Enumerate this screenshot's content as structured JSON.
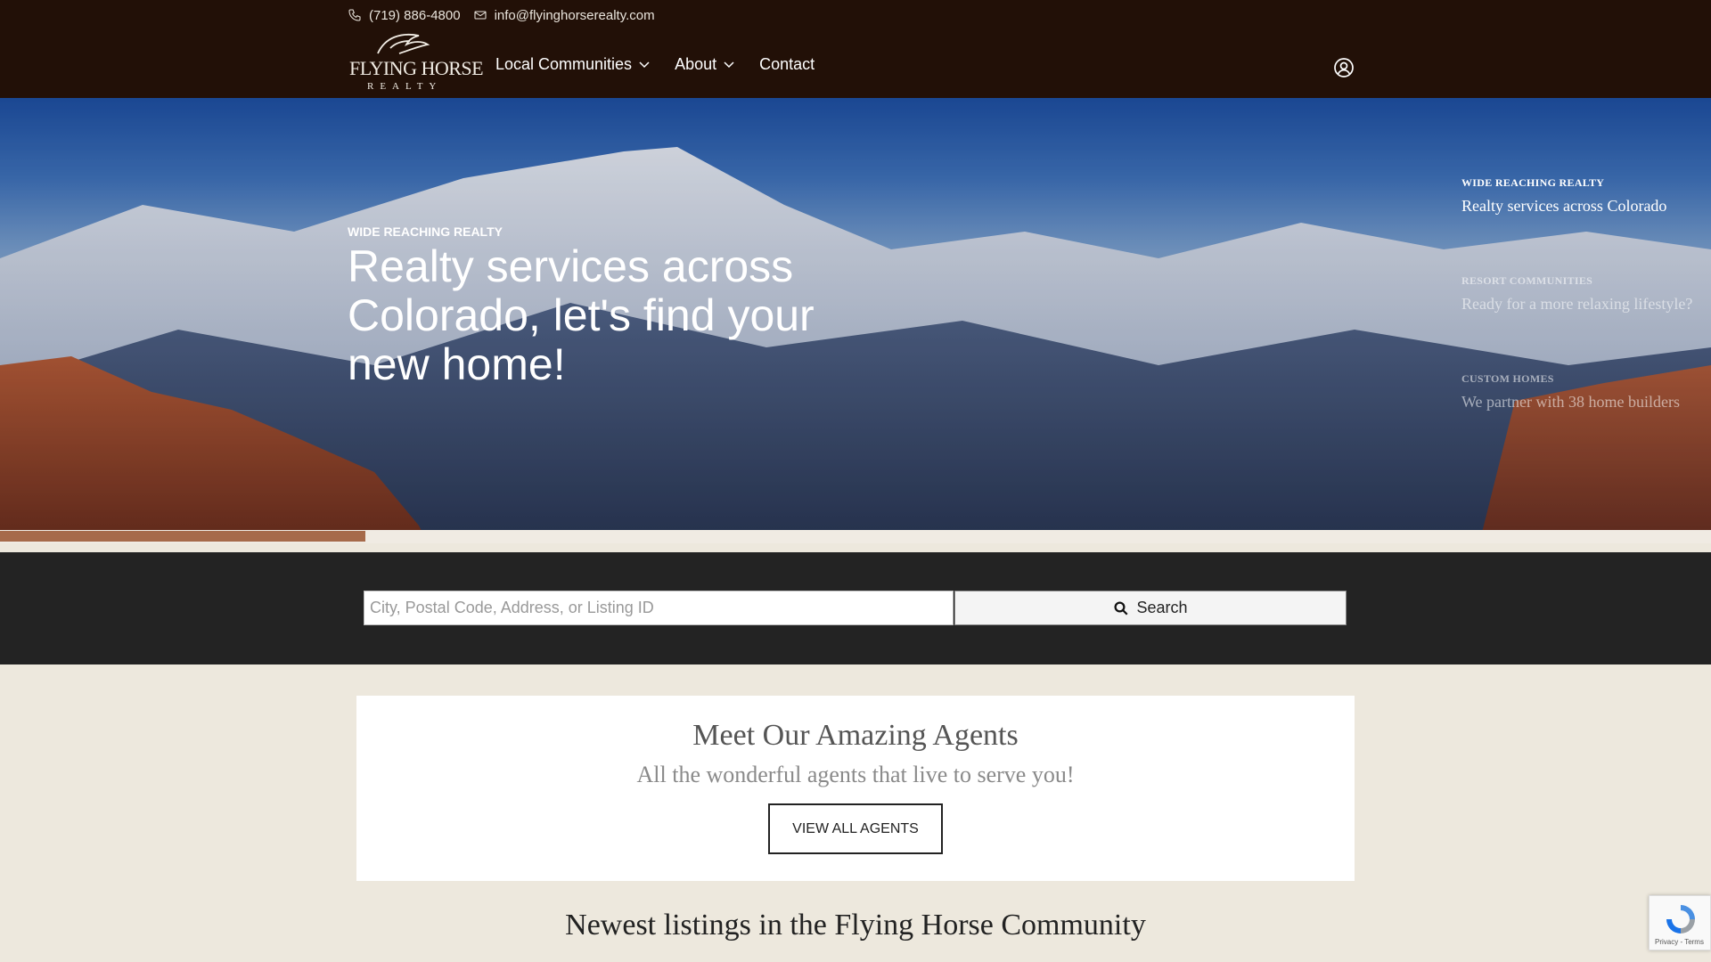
{
  "header": {
    "phone": "(719) 886-4800",
    "email": "info@flyinghorserealty.com",
    "logo": {
      "line1": "FLYING HORSE",
      "line2": "REALTY"
    },
    "nav": [
      {
        "label": "Local Communities",
        "has_dropdown": true
      },
      {
        "label": "About",
        "has_dropdown": true
      },
      {
        "label": "Contact",
        "has_dropdown": false
      }
    ],
    "user_icon": "user-circle-icon"
  },
  "hero": {
    "eyebrow": "WIDE REACHING REALTY",
    "title": "Realty services across Colorado, let's find your new home!",
    "slides": [
      {
        "kicker": "WIDE REACHING REALTY",
        "text": "Realty services across Colorado",
        "active": true
      },
      {
        "kicker": "RESORT COMMUNITIES",
        "text": "Ready for a more relaxing lifestyle?",
        "active": false
      },
      {
        "kicker": "CUSTOM HOMES",
        "text": "We partner with 38 home builders",
        "active": false
      }
    ]
  },
  "search": {
    "placeholder": "City, Postal Code, Address, or Listing ID",
    "value": "",
    "button_label": "Search"
  },
  "agents": {
    "heading": "Meet Our Amazing Agents",
    "subheading": "All the wonderful agents that live to serve you!",
    "button_label": "VIEW ALL AGENTS"
  },
  "listings": {
    "heading": "Newest listings in the Flying Horse Community"
  },
  "recaptcha": {
    "label": "Privacy - Terms"
  },
  "colors": {
    "header_bg": "#221007",
    "search_band_bg": "#232323",
    "page_bg": "#ede8dd",
    "accent": "#a66a4a"
  }
}
